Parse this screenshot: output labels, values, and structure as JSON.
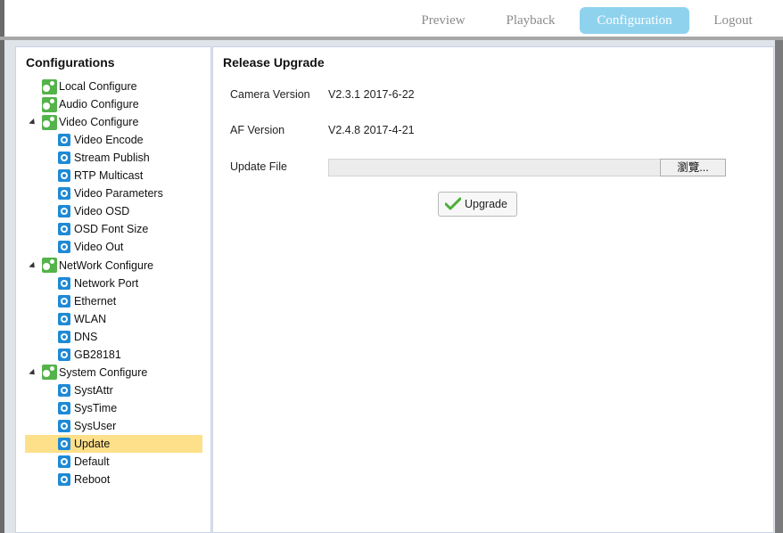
{
  "topnav": {
    "preview": "Preview",
    "playback": "Playback",
    "configuration": "Configuration",
    "logout": "Logout",
    "active": "configuration",
    "active_color": "#8fd2ee"
  },
  "sidebar": {
    "title": "Configurations",
    "items": [
      {
        "label": "Local Configure",
        "icon": "gear-green-icon",
        "level": 0
      },
      {
        "label": "Audio Configure",
        "icon": "gear-green-icon",
        "level": 0
      },
      {
        "label": "Video Configure",
        "icon": "gear-green-icon",
        "level": 0,
        "expanded": true
      },
      {
        "label": "Video Encode",
        "icon": "gear-blue-icon",
        "level": 1
      },
      {
        "label": "Stream Publish",
        "icon": "gear-blue-icon",
        "level": 1
      },
      {
        "label": "RTP Multicast",
        "icon": "gear-blue-icon",
        "level": 1
      },
      {
        "label": "Video Parameters",
        "icon": "gear-blue-icon",
        "level": 1
      },
      {
        "label": "Video OSD",
        "icon": "gear-blue-icon",
        "level": 1
      },
      {
        "label": "OSD Font Size",
        "icon": "gear-blue-icon",
        "level": 1
      },
      {
        "label": "Video Out",
        "icon": "gear-blue-icon",
        "level": 1
      },
      {
        "label": "NetWork Configure",
        "icon": "gear-green-icon",
        "level": 0,
        "expanded": true
      },
      {
        "label": "Network Port",
        "icon": "gear-blue-icon",
        "level": 1
      },
      {
        "label": "Ethernet",
        "icon": "gear-blue-icon",
        "level": 1
      },
      {
        "label": "WLAN",
        "icon": "gear-blue-icon",
        "level": 1
      },
      {
        "label": "DNS",
        "icon": "gear-blue-icon",
        "level": 1
      },
      {
        "label": "GB28181",
        "icon": "gear-blue-icon",
        "level": 1
      },
      {
        "label": "System Configure",
        "icon": "gear-green-icon",
        "level": 0,
        "expanded": true
      },
      {
        "label": "SystAttr",
        "icon": "gear-blue-icon",
        "level": 1
      },
      {
        "label": "SysTime",
        "icon": "gear-blue-icon",
        "level": 1
      },
      {
        "label": "SysUser",
        "icon": "gear-blue-icon",
        "level": 1
      },
      {
        "label": "Update",
        "icon": "gear-blue-icon",
        "level": 1,
        "selected": true
      },
      {
        "label": "Default",
        "icon": "gear-blue-icon",
        "level": 1
      },
      {
        "label": "Reboot",
        "icon": "gear-blue-icon",
        "level": 1
      }
    ],
    "selected_color": "#ffe08a"
  },
  "main": {
    "title": "Release Upgrade",
    "camera_version_label": "Camera Version",
    "camera_version_value": "V2.3.1 2017-6-22",
    "af_version_label": "AF Version",
    "af_version_value": "V2.4.8 2017-4-21",
    "update_file_label": "Update File",
    "update_file_value": "",
    "browse_label": "瀏覽...",
    "upgrade_label": "Upgrade"
  }
}
